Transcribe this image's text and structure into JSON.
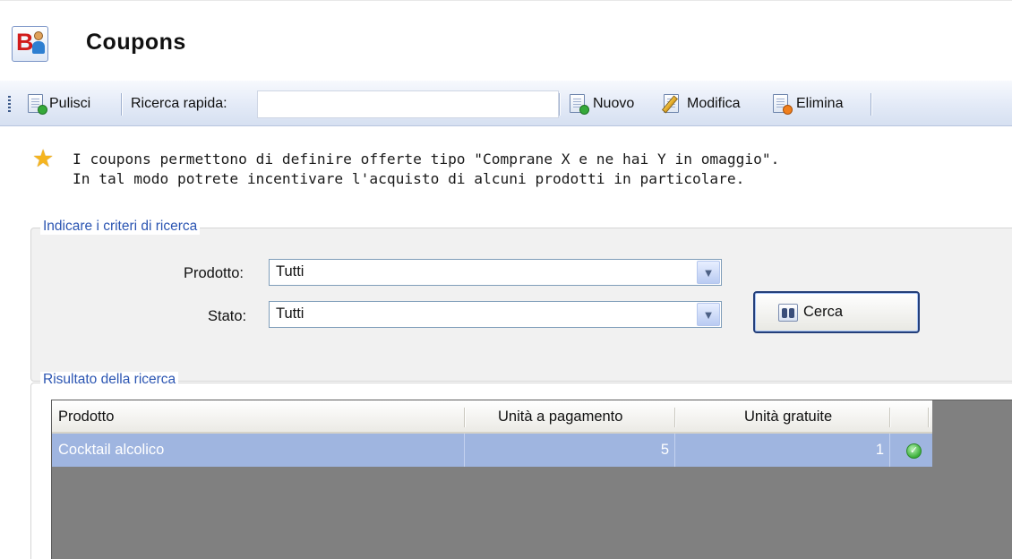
{
  "window": {
    "title": "Coupons"
  },
  "toolbar": {
    "clear_label": "Pulisci",
    "quick_search_label": "Ricerca rapida:",
    "quick_search_value": "",
    "new_label": "Nuovo",
    "edit_label": "Modifica",
    "delete_label": "Elimina"
  },
  "info": {
    "line1": "I coupons permettono di definire offerte tipo \"Comprane X e ne hai Y in omaggio\".",
    "line2": "In tal modo potrete incentivare l'acquisto di alcuni prodotti in particolare."
  },
  "criteria": {
    "legend": "Indicare i criteri di ricerca",
    "product_label": "Prodotto:",
    "product_value": "Tutti",
    "status_label": "Stato:",
    "status_value": "Tutti",
    "search_button": "Cerca"
  },
  "results": {
    "legend": "Risultato della ricerca",
    "columns": [
      "Prodotto",
      "Unità a pagamento",
      "Unità gratuite",
      ""
    ],
    "rows": [
      {
        "product": "Cocktail alcolico",
        "paid_units": "5",
        "free_units": "1",
        "status_icon": "check-circle-icon"
      }
    ]
  },
  "colors": {
    "accent": "#2b55b2",
    "selected_row": "#9fb5e0",
    "grid_background": "#808080"
  }
}
